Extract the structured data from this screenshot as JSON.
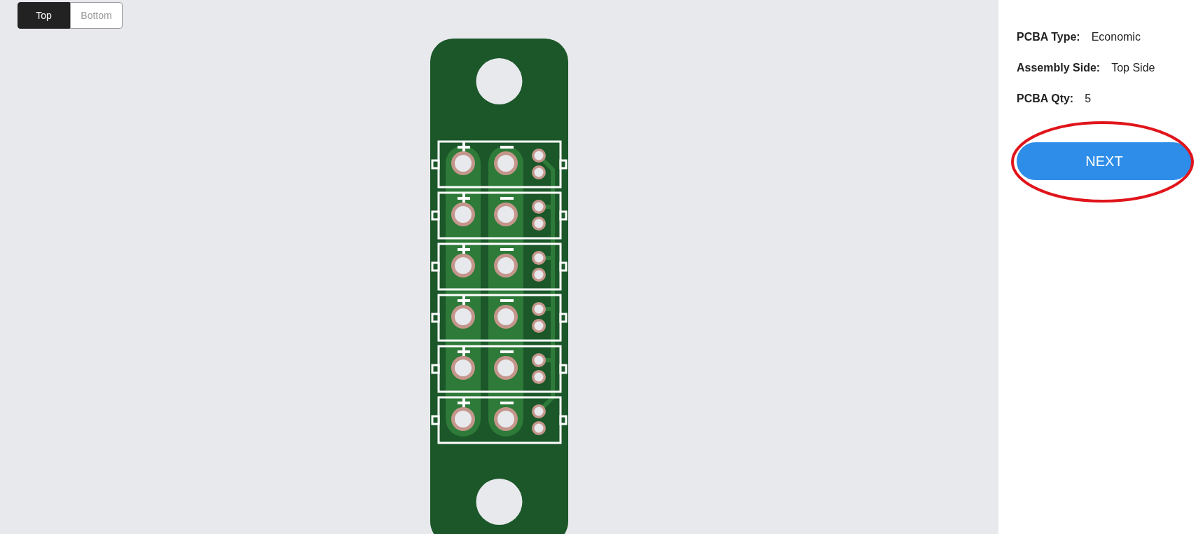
{
  "view_toggle": [
    {
      "label": "Top",
      "selected": true
    },
    {
      "label": "Bottom",
      "selected": false
    }
  ],
  "details": [
    {
      "label": "PCBA Type:",
      "value": "Economic"
    },
    {
      "label": "Assembly Side:",
      "value": "Top Side"
    },
    {
      "label": "PCBA Qty:",
      "value": "5"
    }
  ],
  "next_button": {
    "label": "NEXT",
    "highlighted": true
  }
}
